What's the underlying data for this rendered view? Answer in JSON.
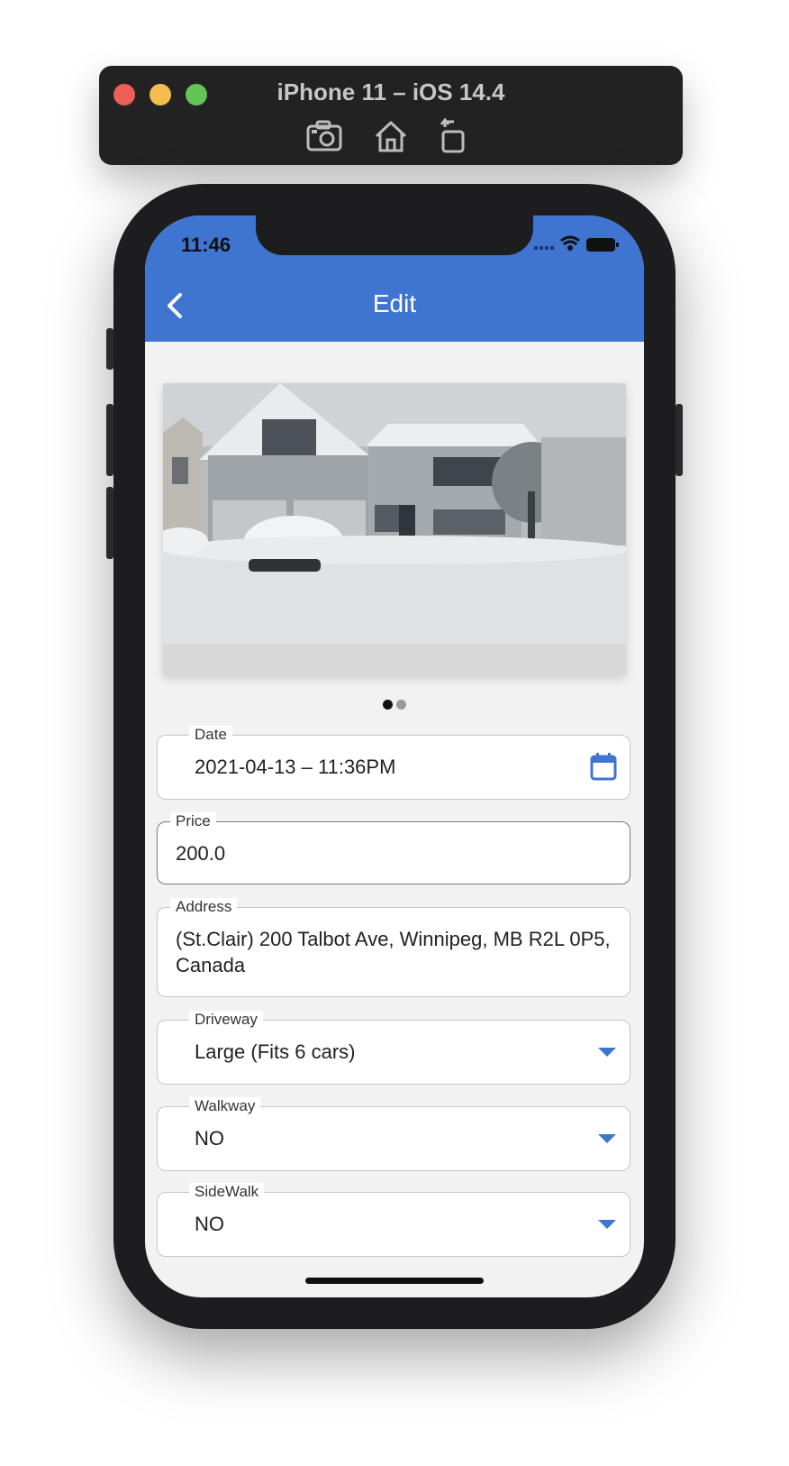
{
  "simulator": {
    "title": "iPhone 11 – iOS 14.4",
    "tools": [
      "screenshot-icon",
      "home-icon",
      "rotate-icon"
    ]
  },
  "status_bar": {
    "time": "11:46"
  },
  "app_bar": {
    "title": "Edit",
    "back_icon": "chevron-left-icon",
    "color": "#3f74d0"
  },
  "carousel": {
    "page_count": 2,
    "active_index": 0
  },
  "form": {
    "date": {
      "label": "Date",
      "value": "2021-04-13 – 11:36PM",
      "icon": "calendar-icon"
    },
    "price": {
      "label": "Price",
      "value": "200.0"
    },
    "address": {
      "label": "Address",
      "value_line1": "(St.Clair) 200 Talbot Ave, Winnipeg, MB R2L 0P5,",
      "value_line2": "Canada"
    },
    "driveway": {
      "label": "Driveway",
      "value": "Large (Fits 6 cars)"
    },
    "walkway": {
      "label": "Walkway",
      "value": "NO"
    },
    "sidewalk": {
      "label": "SideWalk",
      "value": "NO"
    }
  }
}
